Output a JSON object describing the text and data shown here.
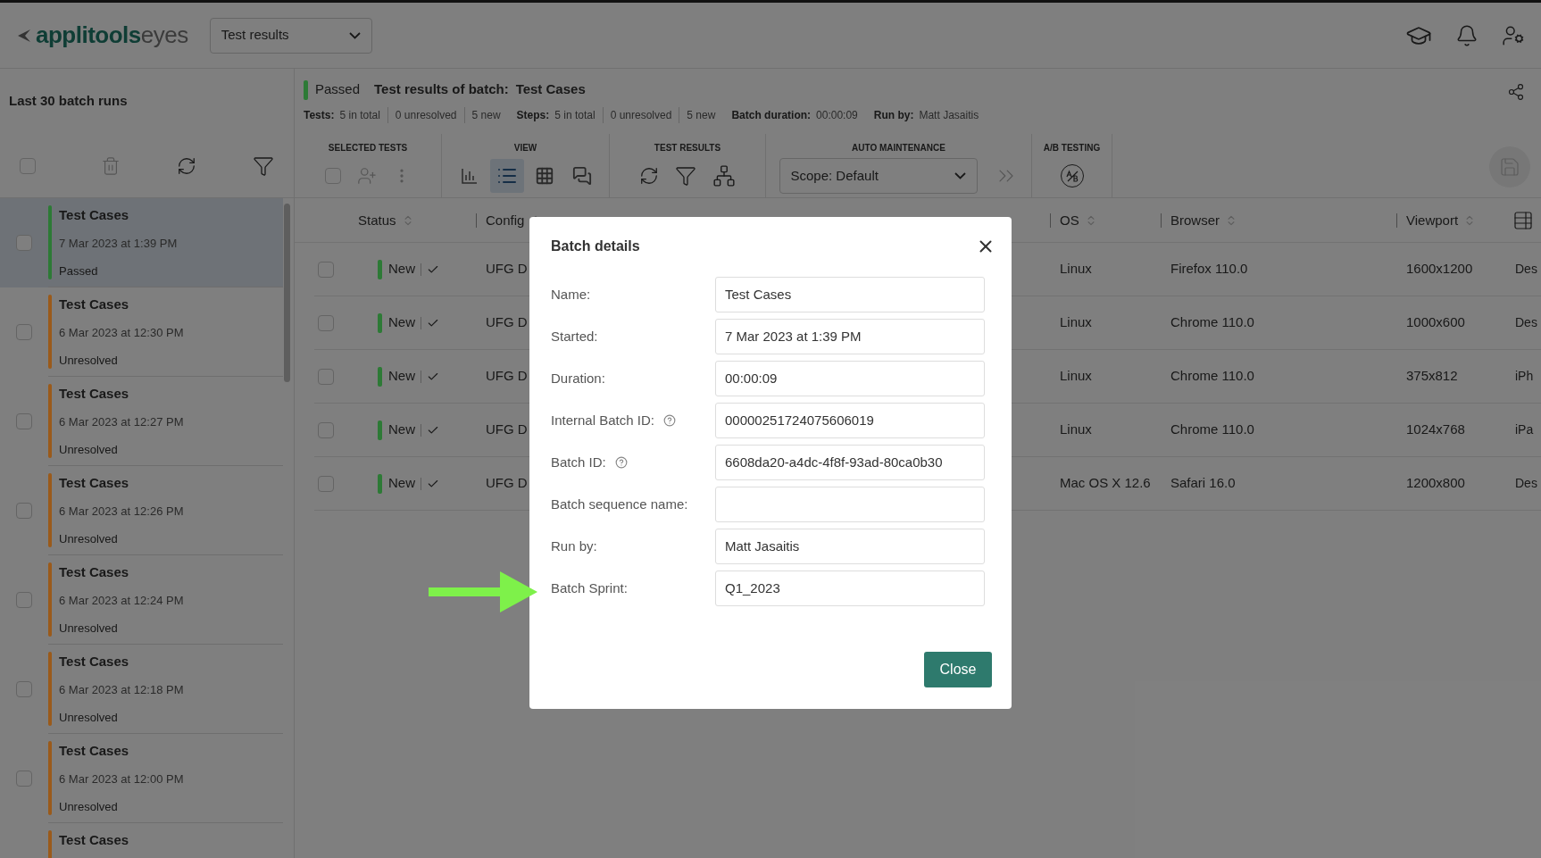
{
  "header": {
    "logo_brand": "applitools",
    "logo_product": "eyes",
    "view_select": "Test results"
  },
  "sidebar": {
    "title": "Last 30 batch runs",
    "select_all_checked": false,
    "batches": [
      {
        "name": "Test Cases",
        "date": "7 Mar 2023 at 1:39 PM",
        "status": "Passed",
        "color": "#2d7a36",
        "selected": true,
        "checked": false
      },
      {
        "name": "Test Cases",
        "date": "6 Mar 2023 at 12:30 PM",
        "status": "Unresolved",
        "color": "#9a5a1a",
        "selected": false,
        "checked": false
      },
      {
        "name": "Test Cases",
        "date": "6 Mar 2023 at 12:27 PM",
        "status": "Unresolved",
        "color": "#9a5a1a",
        "selected": false,
        "checked": false
      },
      {
        "name": "Test Cases",
        "date": "6 Mar 2023 at 12:26 PM",
        "status": "Unresolved",
        "color": "#9a5a1a",
        "selected": false,
        "checked": false
      },
      {
        "name": "Test Cases",
        "date": "6 Mar 2023 at 12:24 PM",
        "status": "Unresolved",
        "color": "#9a5a1a",
        "selected": false,
        "checked": false
      },
      {
        "name": "Test Cases",
        "date": "6 Mar 2023 at 12:18 PM",
        "status": "Unresolved",
        "color": "#9a5a1a",
        "selected": false,
        "checked": false
      },
      {
        "name": "Test Cases",
        "date": "6 Mar 2023 at 12:00 PM",
        "status": "Unresolved",
        "color": "#9a5a1a",
        "selected": false,
        "checked": false
      },
      {
        "name": "Test Cases",
        "color": "#9a5a1a",
        "selected": false
      }
    ]
  },
  "batch_header": {
    "status": "Passed",
    "color": "#2d7a36",
    "title_label": "Test results of batch:",
    "title_value": "Test Cases",
    "stats": [
      {
        "label": "Tests:",
        "values": [
          "5 in total",
          "0 unresolved",
          "5 new"
        ]
      },
      {
        "label": "Steps:",
        "values": [
          "5 in total",
          "0 unresolved",
          "5 new"
        ]
      },
      {
        "label": "Batch duration:",
        "values": [
          "00:00:09"
        ]
      },
      {
        "label": "Run by:",
        "values": [
          "Matt Jasaitis"
        ]
      }
    ]
  },
  "toolbar": {
    "groups": [
      {
        "title": "SELECTED TESTS"
      },
      {
        "title": "VIEW"
      },
      {
        "title": "TEST RESULTS"
      },
      {
        "title": "AUTO MAINTENANCE"
      },
      {
        "title": "A/B TESTING"
      }
    ],
    "select_checked": false,
    "view_buttons": [
      {
        "selected": false
      },
      {
        "selected": true
      },
      {
        "selected": false
      },
      {
        "selected": false
      }
    ],
    "scope_select": "Scope: Default"
  },
  "table": {
    "columns": [
      "Status",
      "Config",
      "OS",
      "Browser",
      "Viewport"
    ],
    "rows": [
      {
        "checked": false,
        "status": "New",
        "color": "#2d7a36",
        "config": "UFG D",
        "os": "Linux",
        "browser": "Firefox 110.0",
        "viewport": "1600x1200",
        "column_6": "Des"
      },
      {
        "checked": false,
        "status": "New",
        "color": "#2d7a36",
        "config": "UFG D",
        "os": "Linux",
        "browser": "Chrome 110.0",
        "viewport": "1000x600",
        "column_6": "Des"
      },
      {
        "checked": false,
        "status": "New",
        "color": "#2d7a36",
        "config": "UFG D",
        "os": "Linux",
        "browser": "Chrome 110.0",
        "viewport": "375x812",
        "column_6": "iPh"
      },
      {
        "checked": false,
        "status": "New",
        "color": "#2d7a36",
        "config": "UFG D",
        "os": "Linux",
        "browser": "Chrome 110.0",
        "viewport": "1024x768",
        "column_6": "iPa"
      },
      {
        "checked": false,
        "status": "New",
        "color": "#2d7a36",
        "config": "UFG D",
        "os": "Mac OS X 12.6",
        "browser": "Safari 16.0",
        "viewport": "1200x800",
        "column_6": "Des"
      }
    ]
  },
  "dialog": {
    "title": "Batch details",
    "fields": [
      {
        "label": "Name:",
        "value": "Test Cases",
        "help": false
      },
      {
        "label": "Started:",
        "value": "7 Mar 2023 at 1:39 PM",
        "help": false
      },
      {
        "label": "Duration:",
        "value": "00:00:09",
        "help": false
      },
      {
        "label": "Internal Batch ID:",
        "value": "00000251724075606019",
        "help": true
      },
      {
        "label": "Batch ID:",
        "value": "6608da20-a4dc-4f8f-93ad-80ca0b30",
        "help": true
      },
      {
        "label": "Batch sequence name:",
        "help": false
      },
      {
        "label": "Run by:",
        "value": "Matt Jasaitis",
        "help": false
      },
      {
        "label": "Batch Sprint:",
        "value": "Q1_2023",
        "help": false
      }
    ],
    "close_button": "Close"
  }
}
